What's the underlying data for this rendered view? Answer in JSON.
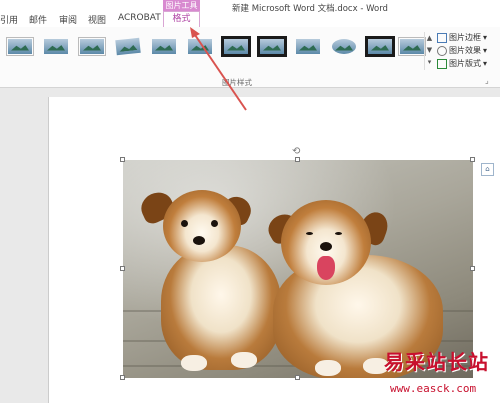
{
  "ribbon_tabs": [
    "引用",
    "邮件",
    "审阅",
    "视图",
    "ACROBAT"
  ],
  "context_group": "图片工具",
  "active_tab": "格式",
  "window_title": "新建 Microsoft Word 文档.docx - Word",
  "ribbon": {
    "group_label": "图片样式",
    "picture_styles_count": 11,
    "side_commands": [
      {
        "label": "图片边框",
        "icon": "border-icon"
      },
      {
        "label": "图片效果",
        "icon": "effects-icon"
      },
      {
        "label": "图片版式",
        "icon": "layout-icon"
      }
    ]
  },
  "watermark": {
    "title": "易采站长站",
    "url": "www.easck.com"
  },
  "colors": {
    "context_accent": "#d88ad0",
    "active_tab_text": "#b046a5",
    "arrow": "#d9534f",
    "watermark": "#c8102e"
  }
}
